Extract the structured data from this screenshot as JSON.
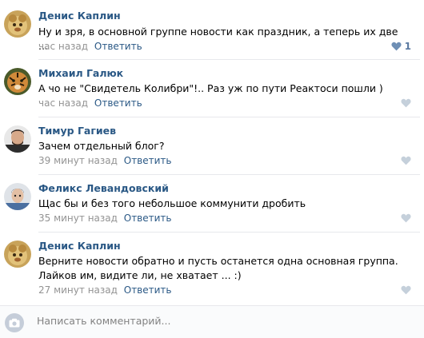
{
  "comments": [
    {
      "author": "Денис Каплин",
      "text": "Ну и зря, в основной группе новости как праздник, а теперь их две ...",
      "time": "час назад",
      "reply": "Ответить",
      "likes": "1"
    },
    {
      "author": "Михаил Галюк",
      "text": "А чо не \"Свидетель Колибри\"!.. Раз уж по пути Реактоси пошли )",
      "time": "час назад",
      "reply": "Ответить"
    },
    {
      "author": "Тимур Гагиев",
      "text": "Зачем отдельный блог?",
      "time": "39 минут назад",
      "reply": "Ответить"
    },
    {
      "author": "Феликс Левандовский",
      "text": "Щас бы и без того небольшое коммунити дробить",
      "time": "35 минут назад",
      "reply": "Ответить"
    },
    {
      "author": "Денис Каплин",
      "text": "Верните новости обратно и пусть останется одна основная группа. Лайков им, видите ли, не хватает ... :)",
      "time": "27 минут назад",
      "reply": "Ответить"
    }
  ],
  "composer": {
    "placeholder": "Написать комментарий...",
    "camera_icon": "camera-icon"
  },
  "colors": {
    "link": "#2a5885",
    "meta": "#939393",
    "like_icon": "#c5d0db"
  }
}
